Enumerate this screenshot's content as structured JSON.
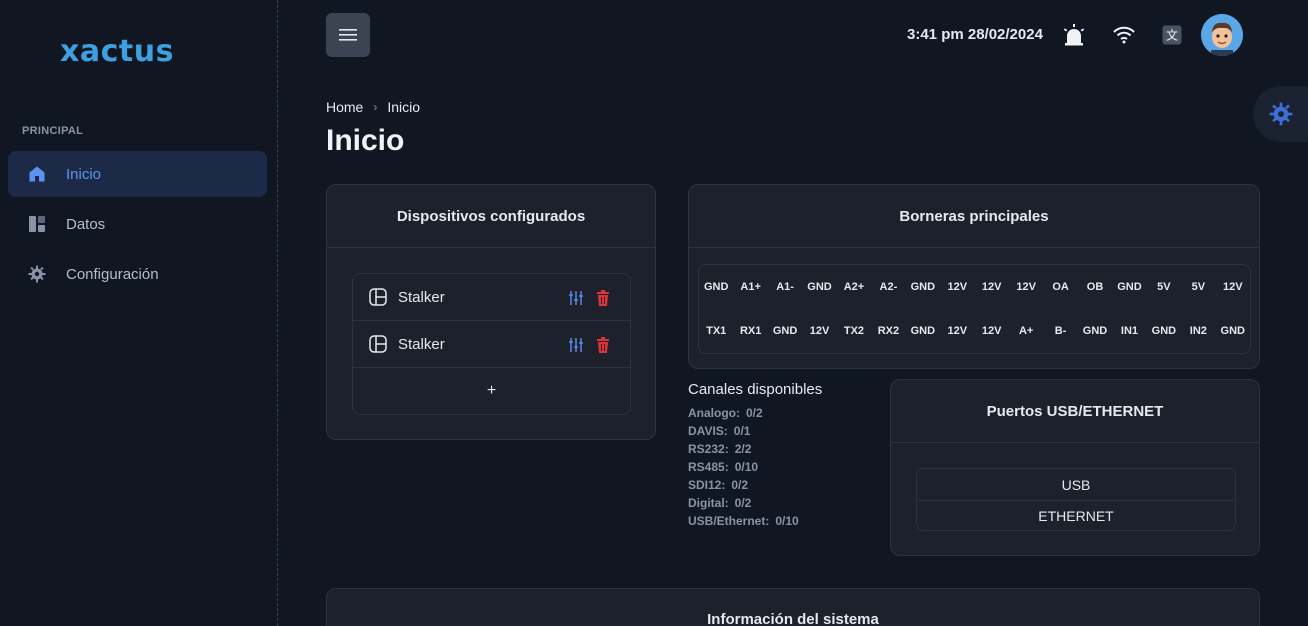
{
  "app": {
    "logo_text": "xactus"
  },
  "sidebar": {
    "section_label": "PRINCIPAL",
    "items": [
      {
        "label": "Inicio",
        "icon": "home-icon",
        "active": true
      },
      {
        "label": "Datos",
        "icon": "dashboard-icon",
        "active": false
      },
      {
        "label": "Configuración",
        "icon": "gear-icon",
        "active": false
      }
    ]
  },
  "topbar": {
    "datetime": "3:41 pm 28/02/2024",
    "icons": [
      "alarm-light-icon",
      "wifi-icon",
      "language-icon"
    ]
  },
  "breadcrumb": {
    "home": "Home",
    "current": "Inicio"
  },
  "page_title": "Inicio",
  "devices_card": {
    "title": "Dispositivos configurados",
    "devices": [
      {
        "name": "Stalker"
      },
      {
        "name": "Stalker"
      }
    ],
    "add_label": "+"
  },
  "terminals_card": {
    "title": "Borneras principales",
    "row1": [
      "GND",
      "A1+",
      "A1-",
      "GND",
      "A2+",
      "A2-",
      "GND",
      "12V",
      "12V",
      "12V",
      "OA",
      "OB",
      "GND",
      "5V",
      "5V",
      "12V"
    ],
    "row2": [
      "TX1",
      "RX1",
      "GND",
      "12V",
      "TX2",
      "RX2",
      "GND",
      "12V",
      "12V",
      "A+",
      "B-",
      "GND",
      "IN1",
      "GND",
      "IN2",
      "GND"
    ]
  },
  "channels": {
    "title": "Canales disponibles",
    "items": [
      {
        "label": "Analogo:",
        "value": "0/2"
      },
      {
        "label": "DAVIS:",
        "value": "0/1"
      },
      {
        "label": "RS232:",
        "value": "2/2"
      },
      {
        "label": "RS485:",
        "value": "0/10"
      },
      {
        "label": "SDI12:",
        "value": "0/2"
      },
      {
        "label": "Digital:",
        "value": "0/2"
      },
      {
        "label": "USB/Ethernet:",
        "value": "0/10"
      }
    ]
  },
  "ports_card": {
    "title": "Puertos USB/ETHERNET",
    "ports": [
      "USB",
      "ETHERNET"
    ]
  },
  "system_card": {
    "title": "Información del sistema"
  },
  "colors": {
    "accent": "#5b93ee",
    "danger": "#e0333a",
    "logo": "#3fa0e0"
  }
}
